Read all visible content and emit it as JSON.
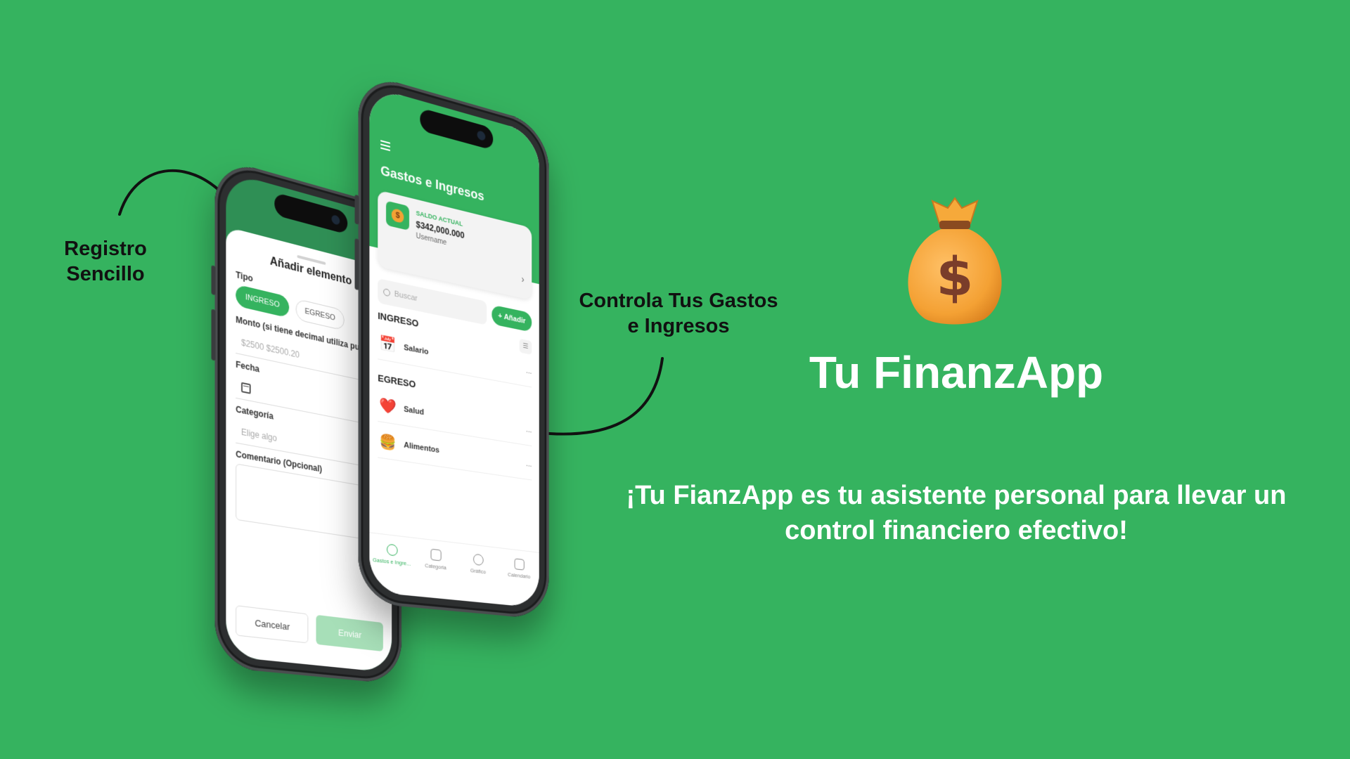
{
  "annotations": {
    "left": "Registro Sencillo",
    "right": "Controla Tus Gastos e Ingresos"
  },
  "form": {
    "title": "Añadir elemento",
    "type_label": "Tipo",
    "type_options": [
      "INGRESO",
      "EGRESO"
    ],
    "amount_label": "Monto (si tiene decimal utiliza punto)",
    "amount_placeholder": "$2500 $2500.20",
    "date_label": "Fecha",
    "category_label": "Categoría",
    "category_placeholder": "Elige algo",
    "comment_label": "Comentario (Opcional)",
    "cancel": "Cancelar",
    "send": "Enviar"
  },
  "app": {
    "title": "Gastos e Ingresos",
    "balance_label": "SALDO ACTUAL",
    "balance_value": "$342,000.000",
    "username": "Username",
    "search_placeholder": "Buscar",
    "add_button": "+ Añadir",
    "income_section": "INGRESO",
    "expense_section": "EGRESO",
    "items": [
      {
        "label": "Salario",
        "icon": "calendar-money-icon"
      },
      {
        "label": "Salud",
        "icon": "heart-pulse-icon"
      },
      {
        "label": "Alimentos",
        "icon": "food-icon"
      }
    ],
    "more": "...",
    "tabs": [
      "Gastos e Ingre...",
      "Categoria",
      "Gráfico",
      "Calendario"
    ]
  },
  "brand": {
    "title": "Tu FinanzApp",
    "tagline": "¡Tu FianzApp es tu asistente personal para llevar un control financiero efectivo!"
  },
  "colors": {
    "background": "#35b35f",
    "accent": "#35b35f",
    "text_dark": "#111111"
  }
}
